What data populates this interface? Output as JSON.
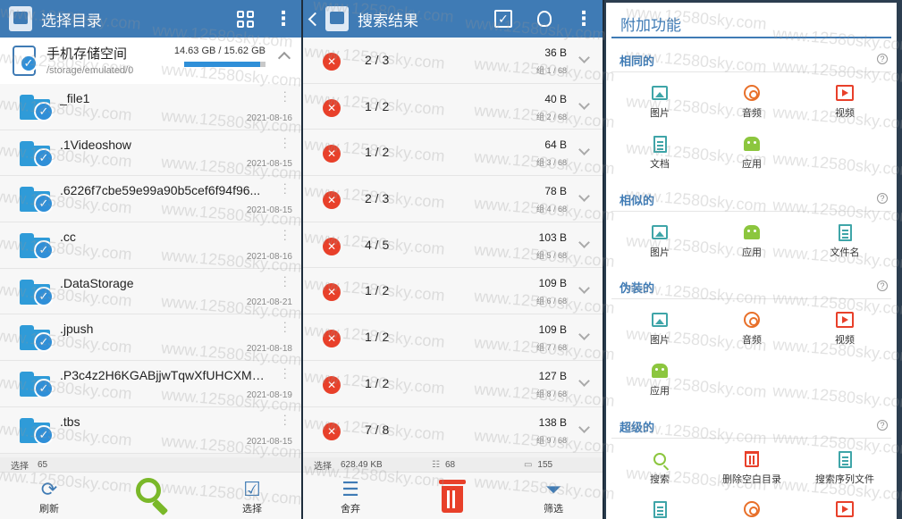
{
  "panel1": {
    "title": "选择目录",
    "storage": {
      "name": "手机存储空间",
      "path": "/storage/emulated/0",
      "size": "14.63 GB / 15.62 GB",
      "used_fraction": 0.937
    },
    "folders": [
      {
        "name": "_file1",
        "date": "2021-08-16"
      },
      {
        "name": ".1Videoshow",
        "date": "2021-08-15"
      },
      {
        "name": ".6226f7cbe59e99a90b5cef6f94f96...",
        "date": "2021-08-15"
      },
      {
        "name": ".cc",
        "date": "2021-08-16"
      },
      {
        "name": ".DataStorage",
        "date": "2021-08-21"
      },
      {
        "name": ".jpush",
        "date": "2021-08-18"
      },
      {
        "name": ".P3c4z2H6KGABjjwTqwXfUHCXMV...",
        "date": "2021-08-19"
      },
      {
        "name": ".tbs",
        "date": "2021-08-15"
      }
    ],
    "status": {
      "label": "选择",
      "value": "65"
    },
    "bottom": {
      "refresh_label": "刷新",
      "select_label": "选择"
    }
  },
  "panel2": {
    "title": "搜索结果",
    "results": [
      {
        "count": "2 / 3",
        "size": "36 B",
        "group": "组 1 / 68"
      },
      {
        "count": "1 / 2",
        "size": "40 B",
        "group": "组 2 / 68"
      },
      {
        "count": "1 / 2",
        "size": "64 B",
        "group": "组 3 / 68"
      },
      {
        "count": "2 / 3",
        "size": "78 B",
        "group": "组 4 / 68"
      },
      {
        "count": "4 / 5",
        "size": "103 B",
        "group": "组 5 / 68"
      },
      {
        "count": "1 / 2",
        "size": "109 B",
        "group": "组 6 / 68"
      },
      {
        "count": "1 / 2",
        "size": "109 B",
        "group": "组 7 / 68"
      },
      {
        "count": "1 / 2",
        "size": "127 B",
        "group": "组 8 / 68"
      },
      {
        "count": "7 / 8",
        "size": "138 B",
        "group": "组 9 / 68"
      }
    ],
    "status": {
      "label": "选择",
      "size": "628.49 KB",
      "groups": "68",
      "files": "155"
    },
    "bottom": {
      "discard_label": "舍弃",
      "filter_label": "筛选"
    }
  },
  "panel3": {
    "title": "附加功能",
    "sections": [
      {
        "title": "相同的",
        "items": [
          "图片",
          "音频",
          "视频",
          "文档",
          "应用"
        ]
      },
      {
        "title": "相似的",
        "items": [
          "图片",
          "应用",
          "文件名"
        ]
      },
      {
        "title": "伪装的",
        "items": [
          "图片",
          "音频",
          "视频",
          "应用"
        ]
      },
      {
        "title": "超级的",
        "items": [
          "搜索",
          "删除空白目录",
          "搜索序列文件"
        ]
      }
    ]
  },
  "watermark": "www.12580sky.com",
  "colors": {
    "primary": "#3f7bb5",
    "accent_red": "#e8402a",
    "accent_green": "#8cc63e",
    "accent_teal": "#3fa5a8"
  }
}
